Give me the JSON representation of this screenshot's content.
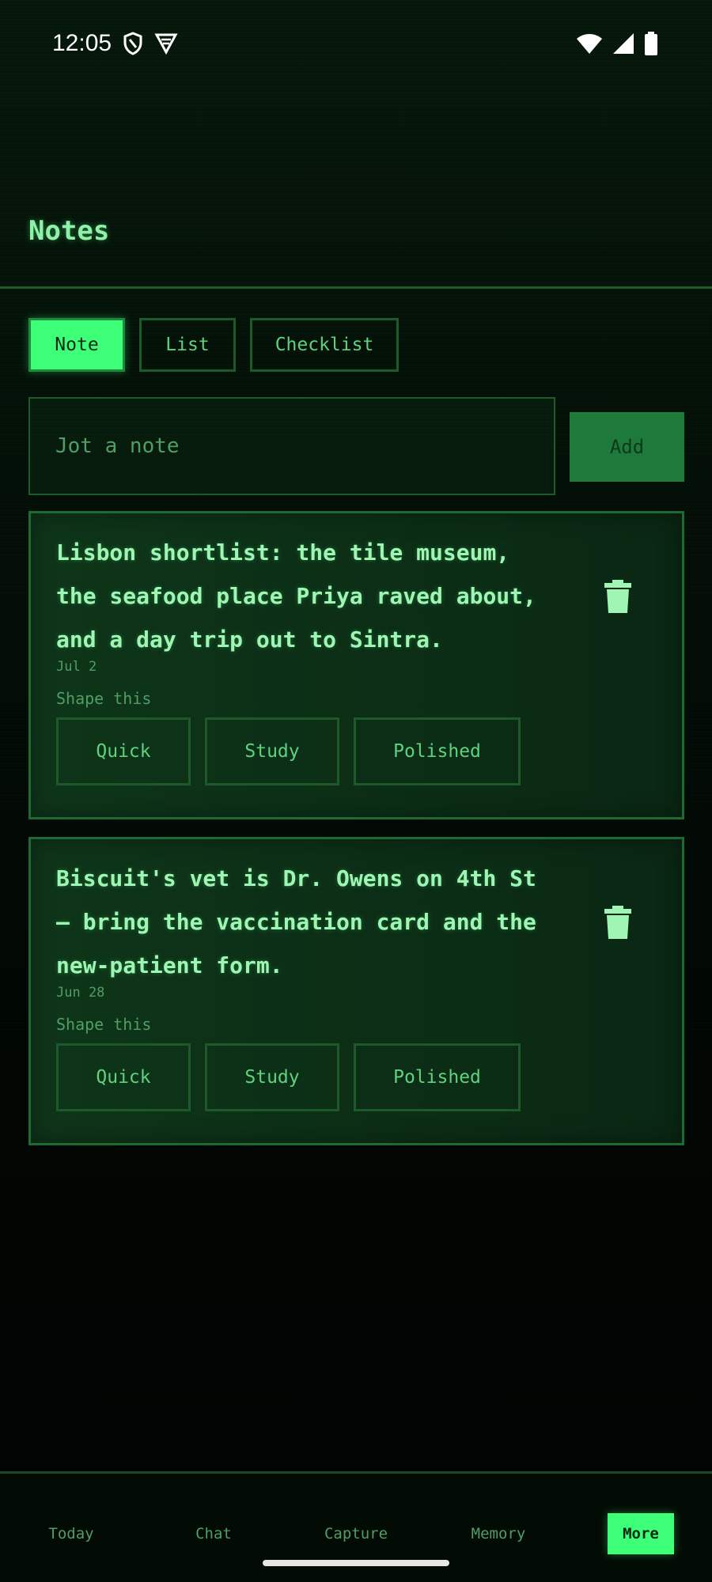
{
  "status_bar": {
    "time": "12:05",
    "icons_left": [
      "shield-icon",
      "vpn-icon"
    ],
    "icons_right": [
      "wifi-icon",
      "signal-icon",
      "battery-icon"
    ]
  },
  "header": {
    "title": "Notes"
  },
  "type_tabs": [
    {
      "label": "Note",
      "active": true
    },
    {
      "label": "List",
      "active": false
    },
    {
      "label": "Checklist",
      "active": false
    }
  ],
  "composer": {
    "placeholder": "Jot a note",
    "value": "",
    "add_label": "Add"
  },
  "notes": [
    {
      "text": "Lisbon shortlist: the tile museum, the seafood place Priya raved about, and a day trip out to Sintra.",
      "date": "Jul 2",
      "shape_label": "Shape this",
      "shape_options": [
        "Quick",
        "Study",
        "Polished"
      ],
      "delete_icon": "trash-icon"
    },
    {
      "text": "Biscuit's vet is Dr. Owens on 4th St — bring the vaccination card and the new-patient form.",
      "date": "Jun 28",
      "shape_label": "Shape this",
      "shape_options": [
        "Quick",
        "Study",
        "Polished"
      ],
      "delete_icon": "trash-icon"
    }
  ],
  "bottom_nav": [
    {
      "label": "Today",
      "active": false
    },
    {
      "label": "Chat",
      "active": false
    },
    {
      "label": "Capture",
      "active": false
    },
    {
      "label": "Memory",
      "active": false
    },
    {
      "label": "More",
      "active": true
    }
  ],
  "colors": {
    "accent": "#3dff78",
    "text": "#7ee89a",
    "muted": "#4f9e65",
    "border": "#1f5a2c",
    "background": "#020804"
  }
}
